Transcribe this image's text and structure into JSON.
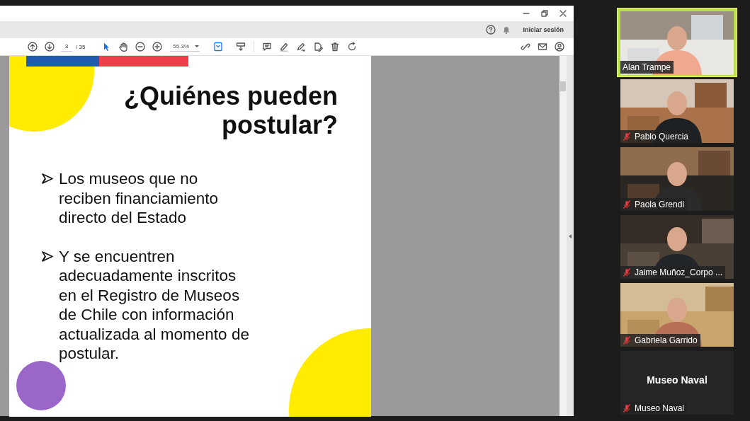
{
  "pdf_viewer": {
    "account": {
      "sign_in": "Iniciar sesión"
    },
    "toolbar": {
      "page_current": "3",
      "page_total": "/ 35",
      "zoom": "55.3%",
      "tools": [
        {
          "kind": "select",
          "selected": true
        },
        {
          "kind": "hand",
          "selected": false
        },
        {
          "kind": "zoom-out",
          "selected": false
        },
        {
          "kind": "zoom-in",
          "selected": false
        }
      ],
      "actions": [
        {
          "kind": "comment"
        },
        {
          "kind": "highlight"
        },
        {
          "kind": "draw"
        },
        {
          "kind": "edit"
        },
        {
          "kind": "delete"
        },
        {
          "kind": "rotate"
        }
      ],
      "right_actions": [
        {
          "kind": "link"
        },
        {
          "kind": "email"
        },
        {
          "kind": "user"
        }
      ]
    },
    "slide": {
      "title": "¿Quiénes pueden postular?",
      "bullets": [
        "Los museos que no reciben financiamiento directo del Estado",
        "Y se encuentren adecuadamente inscritos en el Registro de Museos de Chile con información actualizada al momento de postular."
      ]
    }
  },
  "participants": [
    {
      "name": "Alan Trampe",
      "kind": "video",
      "muted": false,
      "speaking": true
    },
    {
      "name": "Pablo Quercia",
      "kind": "video",
      "muted": true,
      "speaking": false
    },
    {
      "name": "Paola Grendi",
      "kind": "video",
      "muted": true,
      "speaking": false
    },
    {
      "name": "Jaime Muñoz_Corpo ...",
      "kind": "video",
      "muted": true,
      "speaking": false
    },
    {
      "name": "Gabriela Garrido",
      "kind": "video",
      "muted": true,
      "speaking": false
    },
    {
      "name": "Museo Naval",
      "kind": "name",
      "display_name": "Museo Naval",
      "muted": true,
      "speaking": false
    }
  ]
}
